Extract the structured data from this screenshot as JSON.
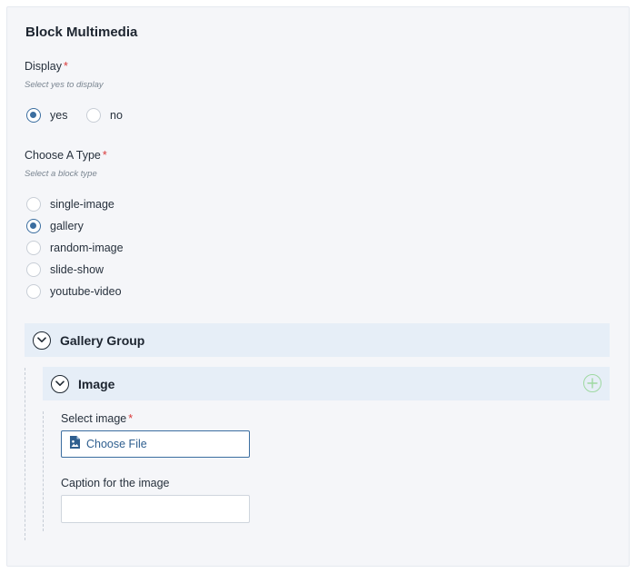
{
  "block": {
    "title": "Block Multimedia"
  },
  "display": {
    "label": "Display",
    "required_mark": "*",
    "hint": "Select yes to display",
    "options": [
      {
        "label": "yes",
        "checked": true
      },
      {
        "label": "no",
        "checked": false
      }
    ]
  },
  "type": {
    "label": "Choose A Type",
    "required_mark": "*",
    "hint": "Select a block type",
    "options": [
      {
        "label": "single-image",
        "checked": false
      },
      {
        "label": "gallery",
        "checked": true
      },
      {
        "label": "random-image",
        "checked": false
      },
      {
        "label": "slide-show",
        "checked": false
      },
      {
        "label": "youtube-video",
        "checked": false
      }
    ]
  },
  "gallery_group": {
    "title": "Gallery Group"
  },
  "image": {
    "title": "Image",
    "select_label": "Select image",
    "required_mark": "*",
    "choose_file_label": "Choose File",
    "caption_label": "Caption for the image",
    "caption_value": ""
  },
  "colors": {
    "accent": "#3b6ea0",
    "required": "#d93a3a",
    "add": "#9fd9a2",
    "header_bg": "#e6eef7"
  }
}
